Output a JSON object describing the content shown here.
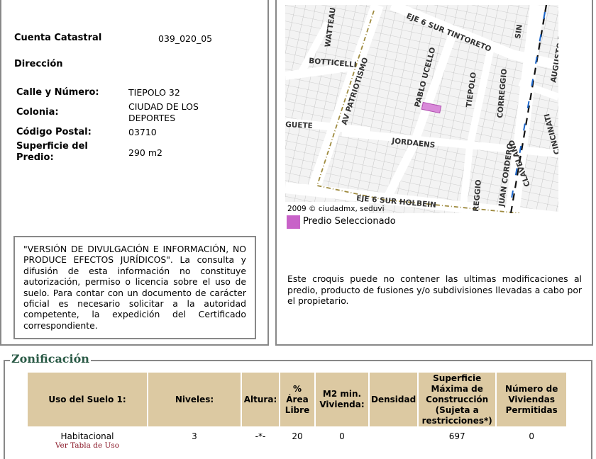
{
  "cuenta": {
    "label": "Cuenta Catastral",
    "value": "039_020_05"
  },
  "direccion_label": "Dirección",
  "address": [
    {
      "label": "Calle y Número:",
      "value": "TIEPOLO 32"
    },
    {
      "label": "Colonia:",
      "value": "CIUDAD DE LOS DEPORTES"
    },
    {
      "label": "Código Postal:",
      "value": "03710"
    },
    {
      "label": "Superficie del Predio:",
      "value": "290 m2"
    }
  ],
  "disclaimer": "\"VERSIÓN DE DIVULGACIÓN E INFORMACIÓN, NO PRODUCE EFECTOS JURÍDICOS\". La consulta y difusión de esta información no constituye autorización, permiso o licencia sobre el uso de suelo. Para contar con un documento de carácter oficial es necesario solicitar a la autoridad competente, la expedición del Certificado correspondiente.",
  "map": {
    "copyright": "2009 © ciudadmx, seduvi",
    "streets": [
      "WATTEAU",
      "EJE 6 SUR TINTORETO",
      "SIN",
      "AUGUSTO RODIN",
      "BOTTICELLI",
      "AV PATRIOTISMO",
      "PABLO UCELLO",
      "TIEPOLO",
      "CORREGGIO",
      "GUETE",
      "JORDAENS",
      "CINCINATI",
      "CLAVELAND",
      "JUAN CORDERO",
      "REGGIO",
      "EJE 6 SUR HOLBEIN"
    ],
    "selected_color": "#c862c8"
  },
  "legend": "Predio Seleccionado",
  "note": "Este croquis puede no contener las ultimas modificaciones al predio, producto de fusiones y/o subdivisiones llevadas a cabo por el propietario.",
  "zonificacion": {
    "title": "Zonificación",
    "headers": [
      "Uso del Suelo 1:",
      "Niveles:",
      "Altura:",
      "% Área Libre",
      "M2 min. Vivienda:",
      "Densidad",
      "Superficie Máxima de Construcción (Sujeta a restricciones*)",
      "Número de Viviendas Permitidas"
    ],
    "row": {
      "uso": "Habitacional",
      "link": "Ver Tabla de Uso",
      "niveles": "3",
      "altura": "-*-",
      "area_libre": "20",
      "m2_min": "0",
      "densidad": "",
      "superficie": "697",
      "viviendas": "0"
    }
  }
}
